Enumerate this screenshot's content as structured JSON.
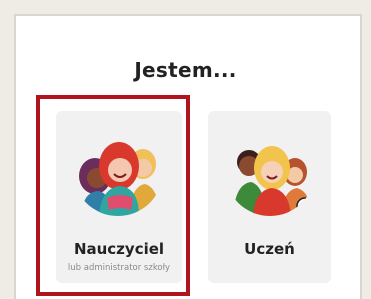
{
  "heading": "Jestem...",
  "options": [
    {
      "label": "Nauczyciel",
      "sublabel": "lub administrator szkoły"
    },
    {
      "label": "Uczeń"
    }
  ],
  "colors": {
    "highlight": "#b0151f",
    "card": "#f1f1f1",
    "background": "#efece6"
  }
}
